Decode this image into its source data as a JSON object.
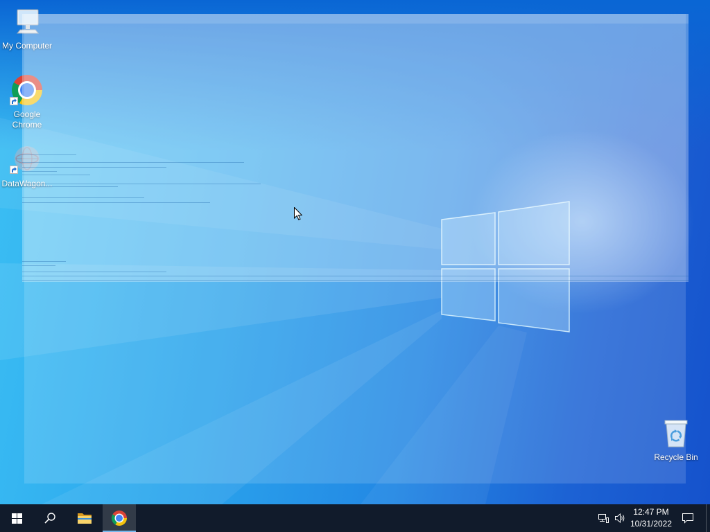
{
  "desktop": {
    "background_colors": {
      "top": "#0a66d4",
      "mid": "#2aa3ec",
      "right": "#1552cc"
    },
    "icons": {
      "my_computer": {
        "label": "My Computer",
        "icon": "computer-icon"
      },
      "google_chrome": {
        "label": "Google Chrome",
        "icon": "chrome-icon",
        "shortcut": true
      },
      "datawagon": {
        "label": "DataWagon...",
        "icon": "datawagon-app-icon",
        "shortcut": true
      },
      "recycle_bin": {
        "label": "Recycle Bin",
        "icon": "recycle-bin-icon"
      }
    },
    "wallpaper_icon": "windows-logo-icon",
    "cursor_icon": "arrow-cursor-icon"
  },
  "taskbar": {
    "background_color": "#111b2b",
    "active_indicator_color": "#76b9ed",
    "start_button": {
      "icon": "windows-logo-icon"
    },
    "search_button": {
      "icon": "search-icon"
    },
    "pinned": [
      {
        "icon": "folder-icon",
        "active": false
      },
      {
        "icon": "chrome-icon",
        "active": true
      }
    ],
    "tray": {
      "icons": [
        "network-icon",
        "volume-icon"
      ],
      "time": "12:47 PM",
      "date": "10/31/2022",
      "notification_icon": "action-center-icon"
    }
  }
}
